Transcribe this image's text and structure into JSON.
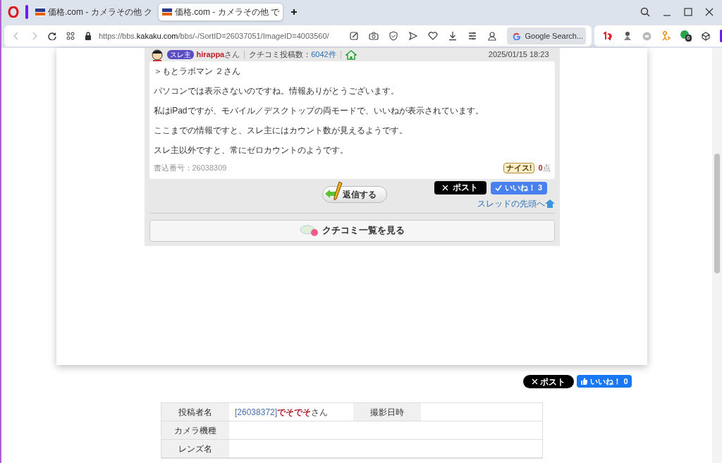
{
  "browser": {
    "tabs": [
      {
        "title": "価格.com - カメラその他 ク",
        "selected": false
      },
      {
        "title": "価格.com - カメラその他 で",
        "selected": true
      }
    ],
    "url_prefix": "https://bbs.",
    "url_host": "kakaku.com",
    "url_path": "/bbs/-/SortID=26037051/ImageID=4003560/",
    "search_placeholder": "Google Search...",
    "extension_badge": "6"
  },
  "post": {
    "badge": "スレ主",
    "author": "hirappa",
    "author_suffix": "さん",
    "count_label": "クチコミ投稿数：",
    "count": "6042件",
    "date": "2025/01/15 18:23",
    "paragraphs": [
      "＞もとラボマン ２さん",
      "パソコンでは表示さないのですね。情報ありがとうございます。",
      "私はiPadですが、モバイル／デスクトップの両モードで、いいねが表示されています。",
      "ここまでの情報ですと、スレ主にはカウント数が見えるようです。",
      "スレ主以外ですと、常にゼロカウントのようです。"
    ],
    "post_number": "書込番号：26038309",
    "nice_button": "ナイス!",
    "nice_score": "0",
    "nice_unit": "点",
    "reply_button": "返信する",
    "x_post": "ポスト",
    "like_label": "いいね！",
    "like_count": "3",
    "thread_top_link": "スレッドの先頭へ",
    "list_button": "クチコミ一覧を見る"
  },
  "share": {
    "x_post": "ポスト",
    "like_label": "いいね！",
    "like_count": "0"
  },
  "table": {
    "rows": [
      {
        "label": "投稿者名",
        "poster_id": "[26038372]",
        "poster_name": "でそでそ",
        "poster_suffix": "さん",
        "label_2": "撮影日時"
      },
      {
        "label": "カメラ機種"
      },
      {
        "label": "レンズ名"
      }
    ]
  }
}
